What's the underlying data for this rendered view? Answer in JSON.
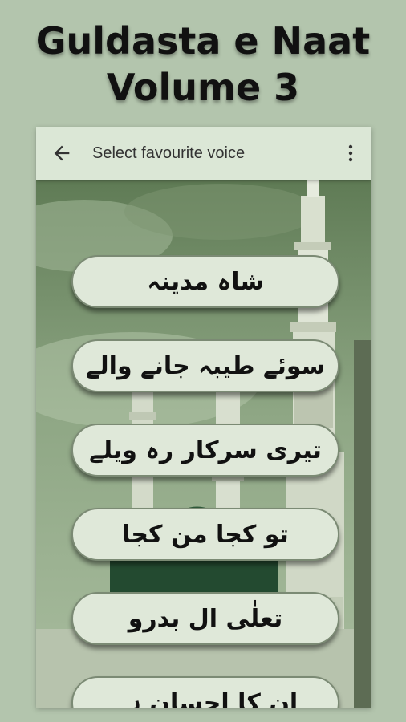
{
  "promo": {
    "title_line1": "Guldasta e Naat",
    "title_line2": "Volume 3"
  },
  "appbar": {
    "title": "Select favourite voice",
    "back_icon": "arrow-left-icon",
    "menu_icon": "more-vertical-icon"
  },
  "voices": [
    {
      "label": "شاہ مدینہ"
    },
    {
      "label": "سوئے طیبہ جانے والے"
    },
    {
      "label": "تیری سرکار رہ ویلے"
    },
    {
      "label": "تو کجا من کجا"
    },
    {
      "label": "تعلٰی ال بدرو"
    },
    {
      "label": "ان کا احسان ہے"
    }
  ],
  "colors": {
    "page_bg": "#b3c5ad",
    "appbar_bg": "#dbe7d6",
    "button_bg": "#dfe8d9",
    "button_border": "#7b8a74"
  }
}
